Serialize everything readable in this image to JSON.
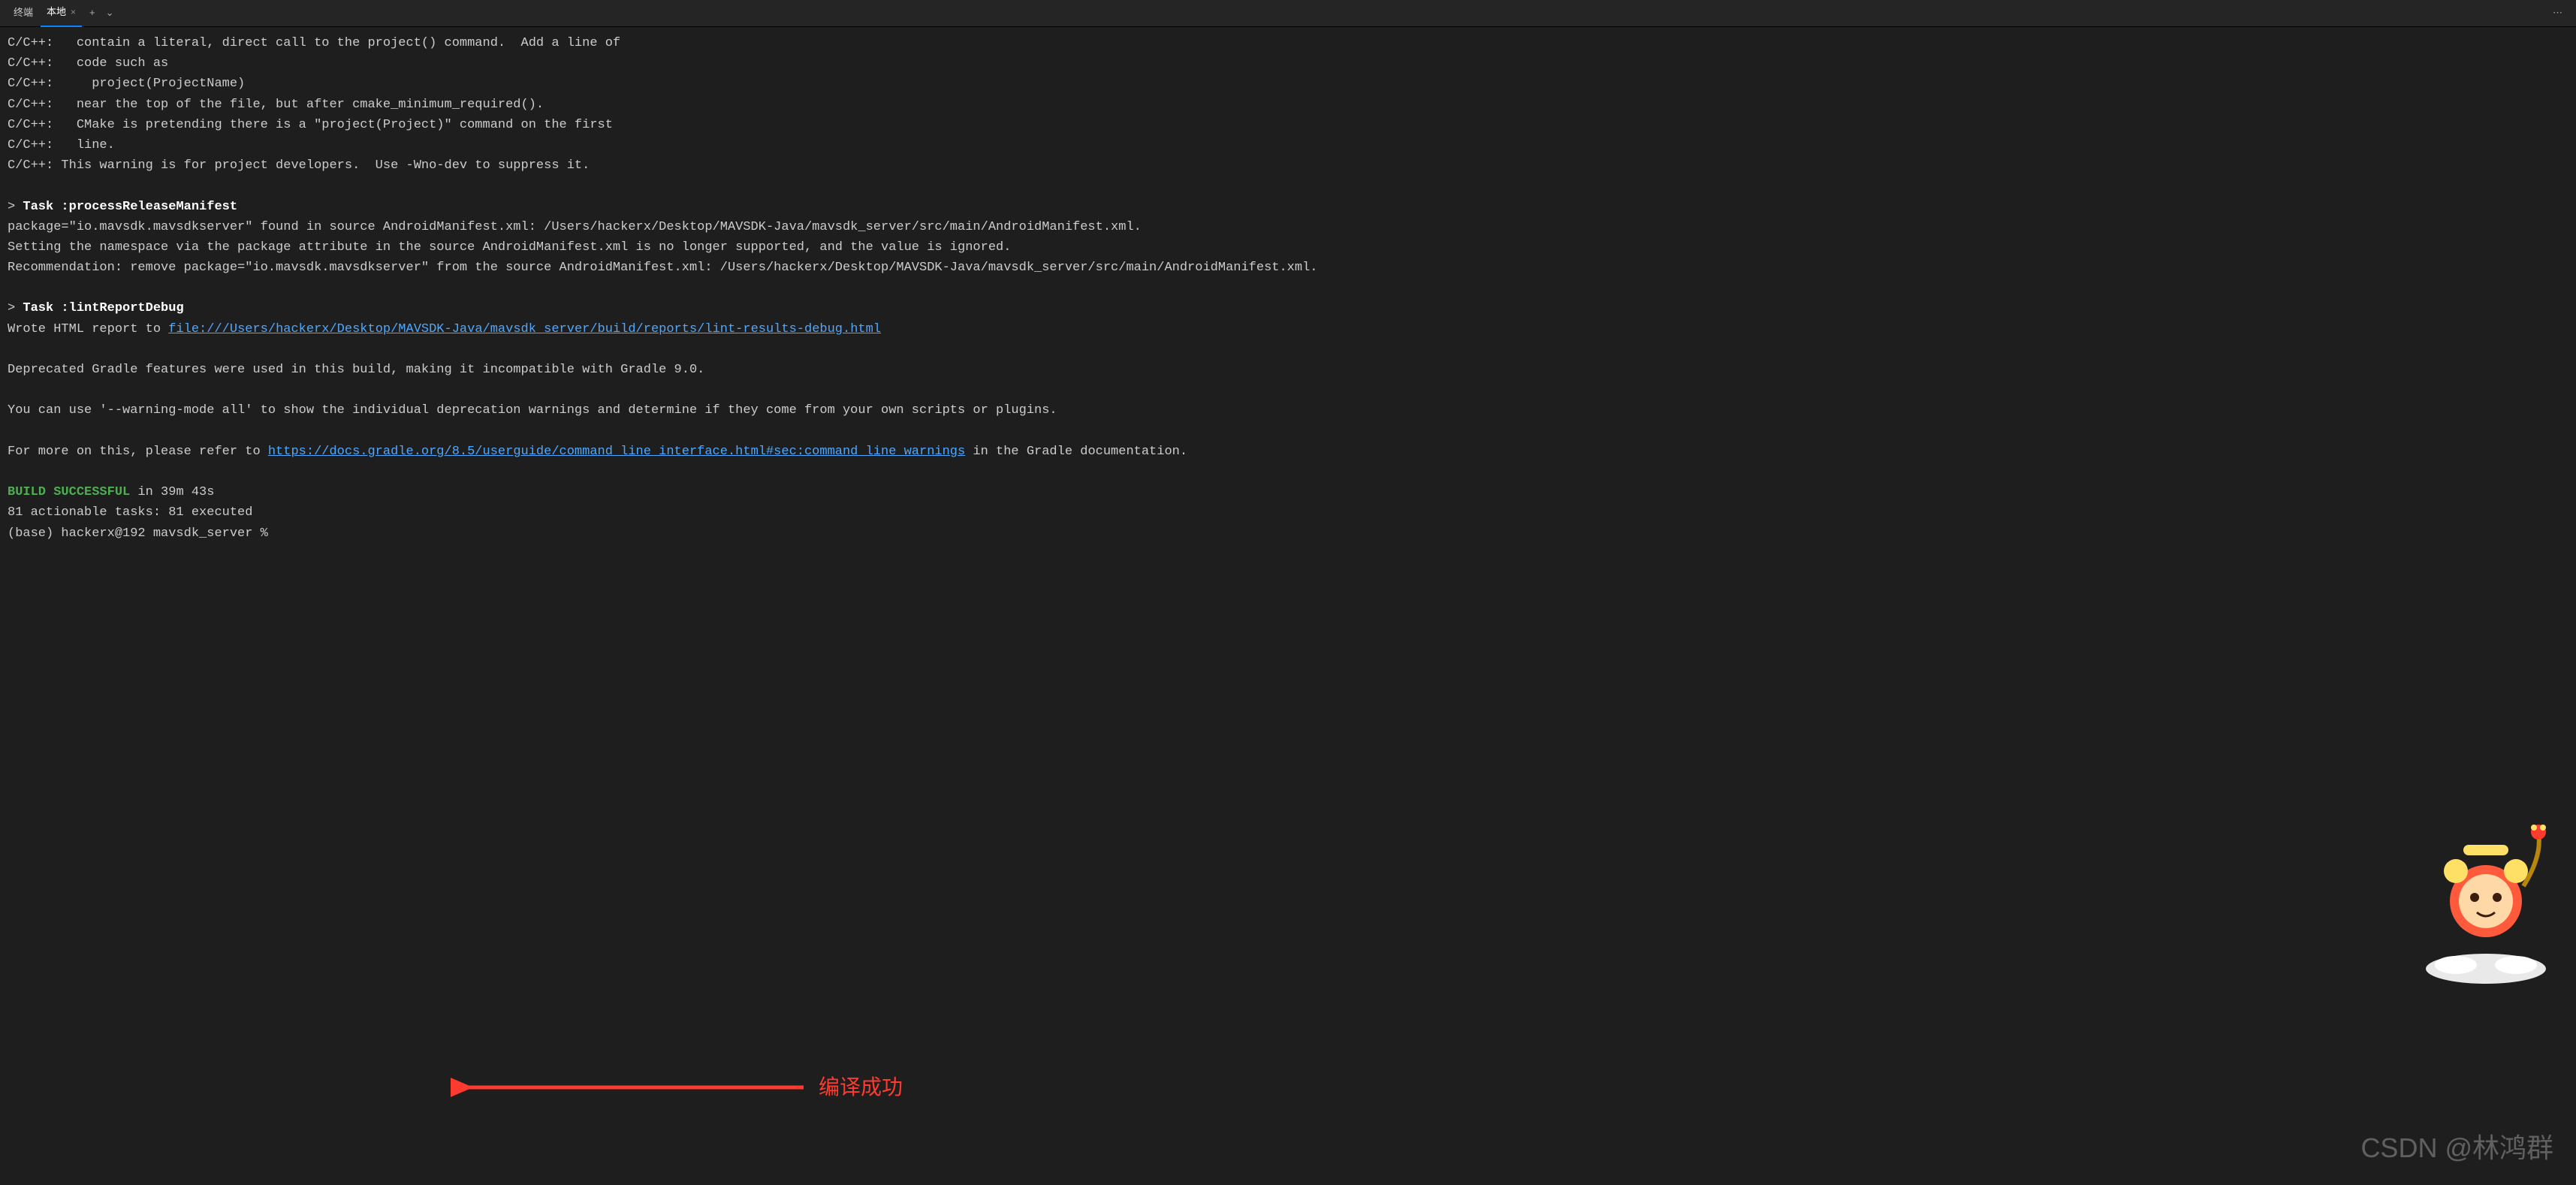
{
  "tabs": {
    "group_label": "终端",
    "active_label": "本地",
    "plus": "+",
    "chevron": "⌄",
    "more": "⋯",
    "close_x": "×"
  },
  "terminal": {
    "lines": {
      "l1": "C/C++:   contain a literal, direct call to the project() command.  Add a line of",
      "l2": "C/C++:   code such as",
      "l3": "C/C++:     project(ProjectName)",
      "l4": "C/C++:   near the top of the file, but after cmake_minimum_required().",
      "l5": "C/C++:   CMake is pretending there is a \"project(Project)\" command on the first",
      "l6": "C/C++:   line.",
      "l7": "C/C++: This warning is for project developers.  Use -Wno-dev to suppress it.",
      "l8": "",
      "l9_prefix": "> ",
      "l9_bold": "Task :processReleaseManifest",
      "l10": "package=\"io.mavsdk.mavsdkserver\" found in source AndroidManifest.xml: /Users/hackerx/Desktop/MAVSDK-Java/mavsdk_server/src/main/AndroidManifest.xml.",
      "l11": "Setting the namespace via the package attribute in the source AndroidManifest.xml is no longer supported, and the value is ignored.",
      "l12": "Recommendation: remove package=\"io.mavsdk.mavsdkserver\" from the source AndroidManifest.xml: /Users/hackerx/Desktop/MAVSDK-Java/mavsdk_server/src/main/AndroidManifest.xml.",
      "l13": "",
      "l14_prefix": "> ",
      "l14_bold": "Task :lintReportDebug",
      "l15_prefix": "Wrote HTML report to ",
      "l15_link": "file:///Users/hackerx/Desktop/MAVSDK-Java/mavsdk_server/build/reports/lint-results-debug.html",
      "l16": "",
      "l17": "Deprecated Gradle features were used in this build, making it incompatible with Gradle 9.0.",
      "l18": "",
      "l19": "You can use '--warning-mode all' to show the individual deprecation warnings and determine if they come from your own scripts or plugins.",
      "l20": "",
      "l21_prefix": "For more on this, please refer to ",
      "l21_link": "https://docs.gradle.org/8.5/userguide/command_line_interface.html#sec:command_line_warnings",
      "l21_suffix": " in the Gradle documentation.",
      "l22": "",
      "l23_success": "BUILD SUCCESSFUL",
      "l23_rest": " in 39m 43s",
      "l24": "81 actionable tasks: 81 executed",
      "l25": "(base) hackerx@192 mavsdk_server % "
    }
  },
  "annotation": {
    "text": "编译成功",
    "arrow_color": "#ff3b30"
  },
  "watermark": "CSDN @林鸿群"
}
